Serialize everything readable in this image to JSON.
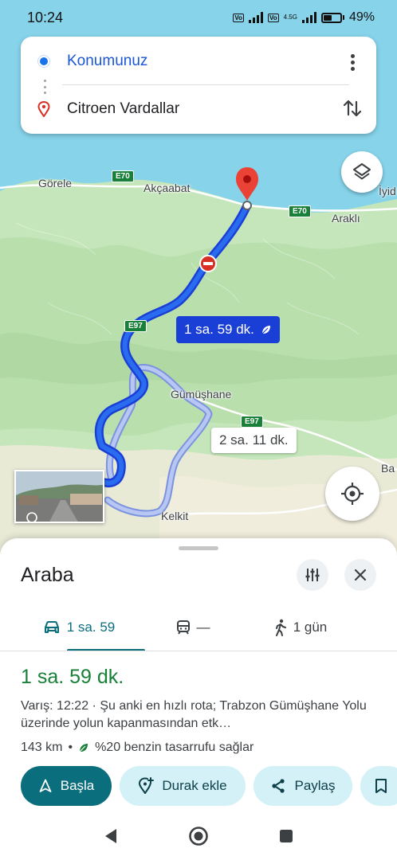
{
  "status_bar": {
    "time": "10:24",
    "battery": "49%",
    "network_label": "4.5G"
  },
  "directions": {
    "origin": "Konumunuz",
    "destination": "Citroen Vardallar"
  },
  "map": {
    "places": [
      "Görele",
      "Akçaabat",
      "Araklı",
      "İyid",
      "Gümüşhane",
      "Kelkit",
      "Ba"
    ],
    "roads": [
      "E70",
      "E70",
      "E97",
      "E97"
    ],
    "primary_route_time": "1 sa. 59 dk.",
    "alternate_route_time": "2 sa. 11 dk."
  },
  "sheet": {
    "title": "Araba",
    "tabs": {
      "drive": "1 sa. 59",
      "transit": "—",
      "walk": "1 gün"
    },
    "eta": "1 sa. 59 dk.",
    "arrival_label": "Varış: 12:22",
    "arrival_detail": " · Şu anki en hızlı rota; Trabzon Gümüşhane Yolu üzerinde yolun kapanmasından etk…",
    "distance": "143 km",
    "savings": "%20 benzin tasarrufu sağlar",
    "buttons": {
      "start": "Başla",
      "add_stop": "Durak ekle",
      "share": "Paylaş"
    }
  },
  "colors": {
    "primary_route": "#1a3fd6",
    "alt_route": "#9fb2ea",
    "accent_teal": "#0b6e7d",
    "eta_green": "#188038",
    "sea": "#7fcfe6",
    "land": "#c6e6bc"
  }
}
